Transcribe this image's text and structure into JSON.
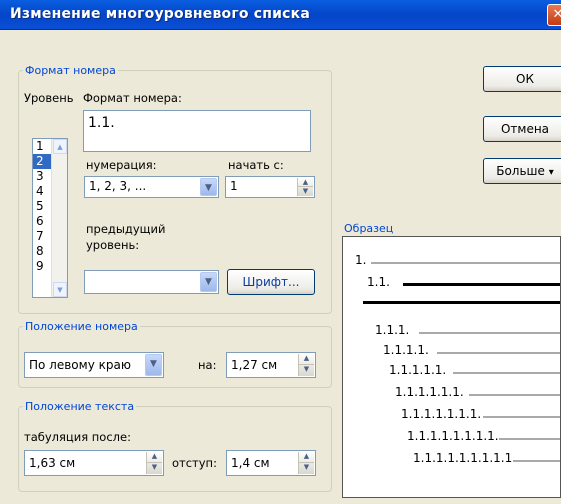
{
  "window": {
    "title": "Изменение многоуровневого списка",
    "close_label": "✕"
  },
  "buttons": {
    "ok": "ОК",
    "cancel": "Отмена",
    "more": "Больше",
    "more_arrow": "▾"
  },
  "number_format": {
    "group_label": "Формат номера",
    "level_label": "Уровень",
    "format_label": "Формат номера:",
    "format_value": "1.1.",
    "levels": [
      "1",
      "2",
      "3",
      "4",
      "5",
      "6",
      "7",
      "8",
      "9"
    ],
    "selected_level": "2",
    "numbering_label": "нумерация:",
    "numbering_value": "1, 2, 3, ...",
    "start_label": "начать с:",
    "start_value": "1",
    "prev_level_label_1": "предыдущий",
    "prev_level_label_2": "уровень:",
    "prev_level_value": "",
    "font_button": "Шрифт..."
  },
  "number_position": {
    "group_label": "Положение номера",
    "align_value": "По левому краю",
    "at_label": "на:",
    "at_value": "1,27 см"
  },
  "text_position": {
    "group_label": "Положение текста",
    "tab_label": "табуляция после:",
    "tab_value": "1,63 см",
    "indent_label": "отступ:",
    "indent_value": "1,4 см"
  },
  "preview": {
    "label": "Образец",
    "rows": [
      "1.",
      "1.1.",
      "1.1.1.",
      "1.1.1.1.",
      "1.1.1.1.1.",
      "1.1.1.1.1.1.",
      "1.1.1.1.1.1.1.",
      "1.1.1.1.1.1.1.1.",
      "1.1.1.1.1.1.1.1.1."
    ]
  }
}
